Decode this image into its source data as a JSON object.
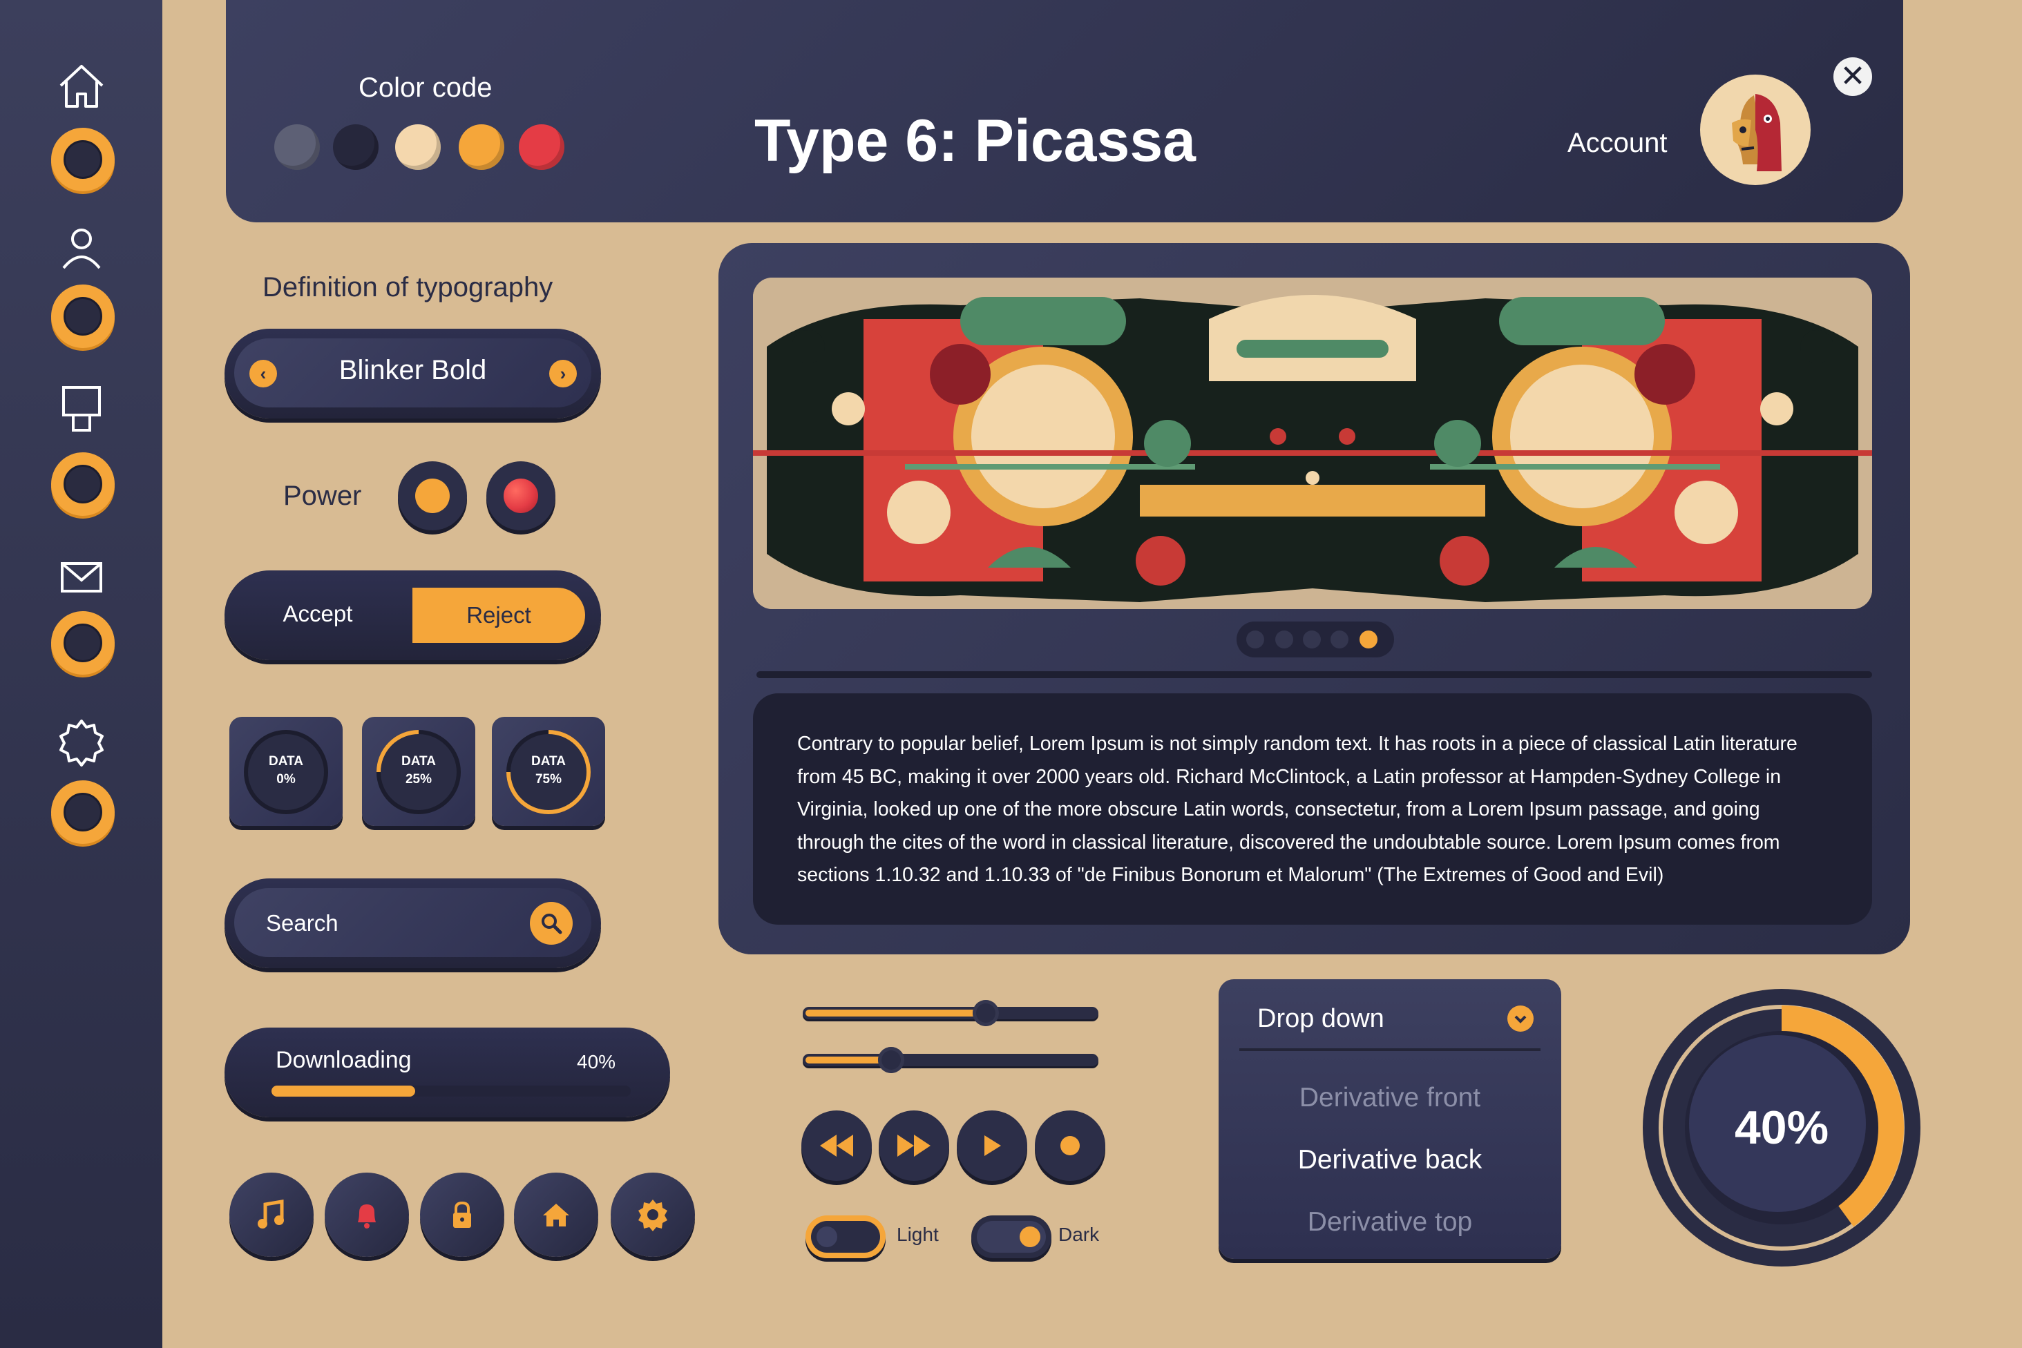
{
  "colors": {
    "navy": "#2a2c45",
    "orange": "#f5a63a",
    "red": "#e43c45",
    "sand": "#d8bb93",
    "cream": "#f4d7ad",
    "slate": "#5d6075"
  },
  "sidebar": {
    "items": [
      {
        "icon": "home-icon"
      },
      {
        "icon": "user-icon"
      },
      {
        "icon": "monitor-icon"
      },
      {
        "icon": "mail-icon"
      },
      {
        "icon": "gear-icon"
      }
    ]
  },
  "header": {
    "color_code_label": "Color code",
    "swatches": [
      "#5d6075",
      "#26273c",
      "#f4d7ad",
      "#f5a63a",
      "#e43c45"
    ],
    "title": "Type 6: Picassa",
    "account_label": "Account",
    "close_glyph": "✕"
  },
  "typography": {
    "label": "Definition of typography",
    "font_name": "Blinker Bold",
    "prev_glyph": "‹",
    "next_glyph": "›"
  },
  "power": {
    "label": "Power"
  },
  "choice": {
    "accept": "Accept",
    "reject": "Reject"
  },
  "data_tiles": [
    {
      "label": "DATA",
      "value": "0%",
      "progress": 0
    },
    {
      "label": "DATA",
      "value": "25%",
      "progress": 0.25
    },
    {
      "label": "DATA",
      "value": "75%",
      "progress": 0.75
    }
  ],
  "search": {
    "placeholder": "Search"
  },
  "download": {
    "label": "Downloading",
    "percent_text": "40%",
    "progress": 0.4
  },
  "quick_icons": [
    "music-icon",
    "bell-icon",
    "lock-icon",
    "home-icon",
    "gear-icon"
  ],
  "media": {
    "pager_count": 5,
    "pager_active": 4,
    "body_text": "Contrary to popular belief, Lorem Ipsum is not simply random text. It has roots in a piece of classical Latin literature from 45 BC, making it over 2000 years old. Richard McClintock, a Latin professor at Hampden-Sydney College in Virginia, looked up one of the more obscure Latin words, consectetur, from a Lorem Ipsum passage, and going through the cites of the word in classical literature, discovered the undoubtable source. Lorem Ipsum comes from sections 1.10.32 and 1.10.33 of \"de Finibus Bonorum et Malorum\" (The Extremes of Good and Evil)"
  },
  "sliders": [
    {
      "value": 0.62
    },
    {
      "value": 0.3
    }
  ],
  "media_buttons": [
    "rewind-icon",
    "fast-forward-icon",
    "play-icon",
    "record-icon"
  ],
  "toggles": {
    "light_label": "Light",
    "dark_label": "Dark"
  },
  "dropdown": {
    "label": "Drop down",
    "options": [
      "Derivative front",
      "Derivative back",
      "Derivative top"
    ],
    "selected_index": 1
  },
  "gauge": {
    "value_text": "40%",
    "progress": 0.4
  }
}
